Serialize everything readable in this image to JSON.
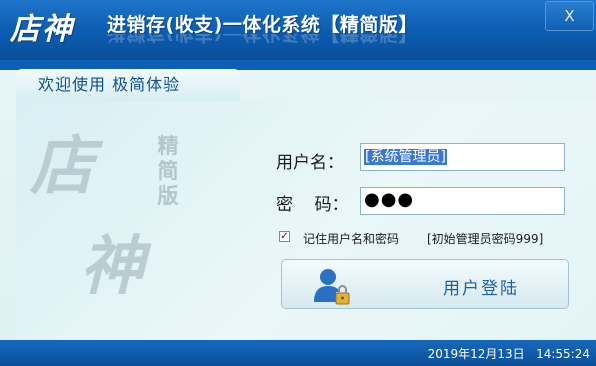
{
  "window": {
    "logo_text": "店神",
    "title": "进销存(收支)一体化系统【精简版】",
    "close_label": "X"
  },
  "tab": {
    "label": "欢迎使用 极简体验"
  },
  "watermark": {
    "logo_text": "店神",
    "edition_chars": [
      "精",
      "简",
      "版"
    ]
  },
  "form": {
    "username_label": "用户名：",
    "username_value": "[系统管理员]",
    "password_label": "密    码：",
    "password_value": "●●●",
    "remember_checked": true,
    "remember_label": "记住用户名和密码",
    "hint": "[初始管理员密码999]",
    "login_label": "用户登陆"
  },
  "status": {
    "datetime": "2019年12月13日   14:55:24"
  },
  "colors": {
    "titlebar": "#0b5cb0",
    "panel_bg": "#e6f4f6",
    "accent_text": "#1c5fa3"
  }
}
